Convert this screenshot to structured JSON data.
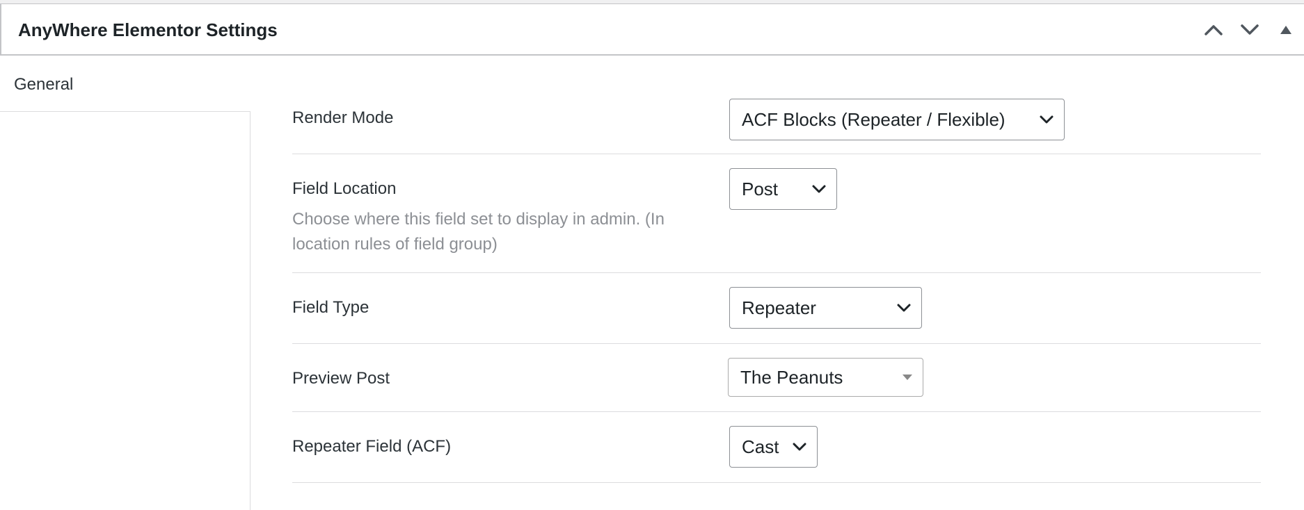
{
  "panel": {
    "title": "AnyWhere Elementor Settings",
    "controls": [
      "move-up",
      "move-down",
      "toggle-panel"
    ]
  },
  "sidebar": {
    "tabs": [
      {
        "label": "General",
        "active": true
      }
    ]
  },
  "settings": {
    "render_mode": {
      "label": "Render Mode",
      "value": "ACF Blocks (Repeater / Flexible)"
    },
    "field_location": {
      "label": "Field Location",
      "value": "Post",
      "description": "Choose where this field set to display in admin. (In location rules of field group)"
    },
    "field_type": {
      "label": "Field Type",
      "value": "Repeater"
    },
    "preview_post": {
      "label": "Preview Post",
      "value": "The Peanuts"
    },
    "repeater_field": {
      "label": "Repeater Field (ACF)",
      "value": "Cast"
    }
  },
  "colors": {
    "border": "#c3c4c7",
    "divider": "#dcdcde",
    "text": "#1d2327",
    "muted": "#8c8f94"
  }
}
